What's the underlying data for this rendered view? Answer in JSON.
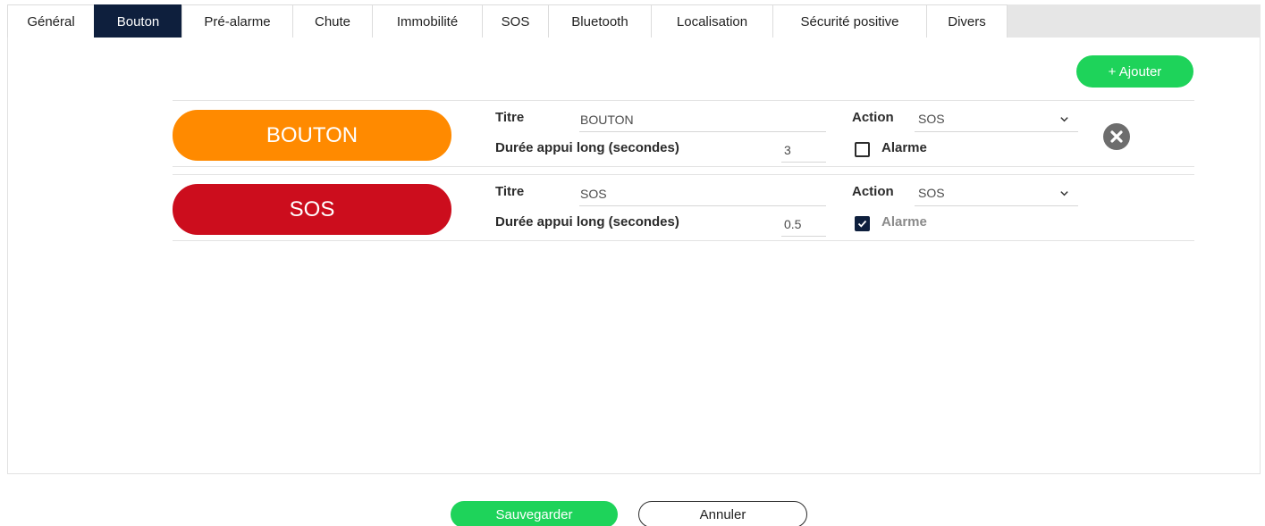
{
  "tabs": [
    {
      "label": "Général"
    },
    {
      "label": "Bouton",
      "active": true
    },
    {
      "label": "Pré-alarme"
    },
    {
      "label": "Chute"
    },
    {
      "label": "Immobilité"
    },
    {
      "label": "SOS"
    },
    {
      "label": "Bluetooth"
    },
    {
      "label": "Localisation"
    },
    {
      "label": "Sécurité positive"
    },
    {
      "label": "Divers"
    }
  ],
  "add_button_label": "+ Ajouter",
  "labels": {
    "titre": "Titre",
    "duree": "Durée appui long (secondes)",
    "action": "Action",
    "alarme": "Alarme"
  },
  "buttons": [
    {
      "pill_label": "BOUTON",
      "pill_color": "#ff8a00",
      "title": "BOUTON",
      "duration": "3",
      "action": "SOS",
      "alarme_checked": false,
      "removable": true
    },
    {
      "pill_label": "SOS",
      "pill_color": "#cc0d1d",
      "title": "SOS",
      "duration": "0.5",
      "action": "SOS",
      "alarme_checked": true,
      "removable": false
    }
  ],
  "icons": {
    "remove": "close-circle-icon",
    "dropdown": "chevron-down-icon",
    "check": "check-icon"
  },
  "footer": {
    "save_label": "Sauvegarder",
    "cancel_label": "Annuler"
  },
  "colors": {
    "active_tab": "#0e1f3d",
    "primary_green": "#1ed35a"
  }
}
